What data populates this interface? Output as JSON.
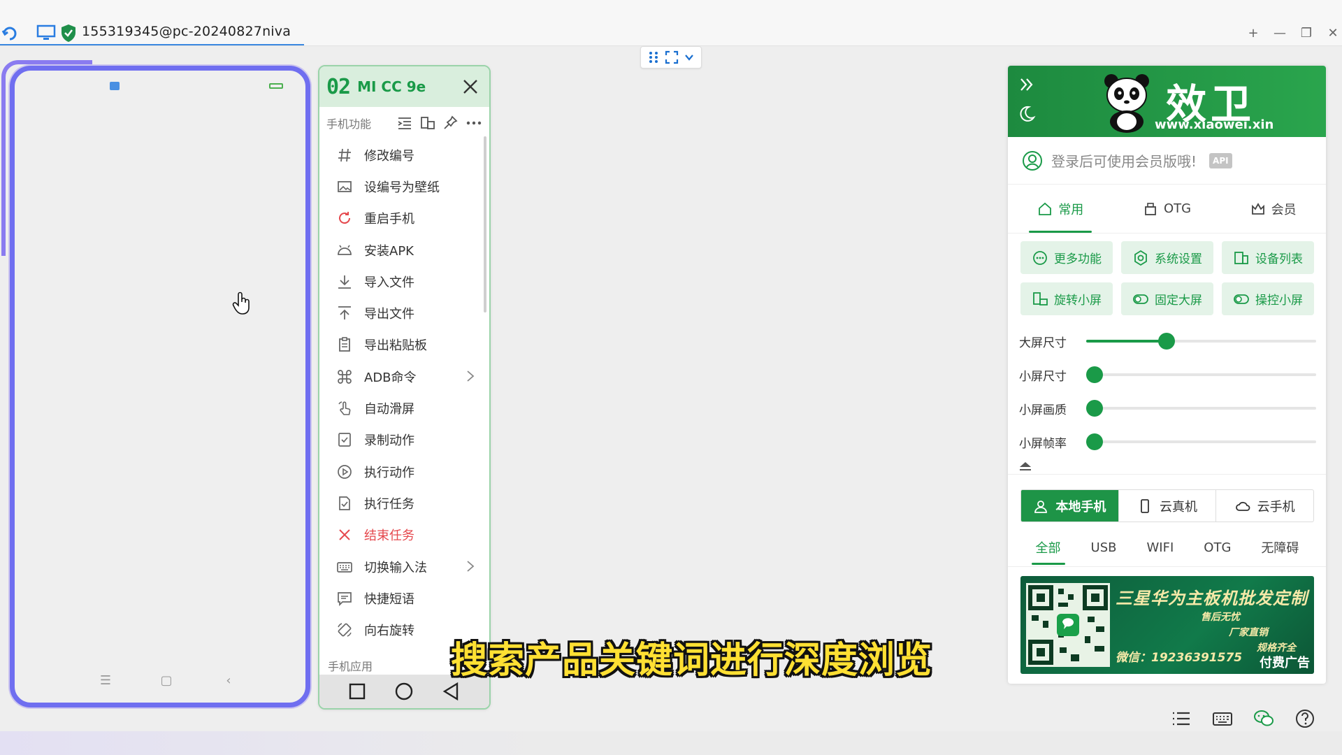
{
  "window": {
    "title": "155319345@pc-20240827niva",
    "controls": [
      "+",
      "—",
      "❐",
      "✕"
    ]
  },
  "menu": {
    "number": "02",
    "model": "MI CC 9e",
    "section_label": "手机功能",
    "apps_label": "手机应用",
    "items": [
      {
        "label": "修改编号",
        "icon": "hash-icon"
      },
      {
        "label": "设编号为壁纸",
        "icon": "image-icon"
      },
      {
        "label": "重启手机",
        "icon": "restart-icon"
      },
      {
        "label": "安装APK",
        "icon": "android-icon"
      },
      {
        "label": "导入文件",
        "icon": "download-icon"
      },
      {
        "label": "导出文件",
        "icon": "upload-icon"
      },
      {
        "label": "导出粘贴板",
        "icon": "clipboard-icon"
      },
      {
        "label": "ADB命令",
        "icon": "command-icon"
      },
      {
        "label": "自动滑屏",
        "icon": "swipe-icon"
      },
      {
        "label": "录制动作",
        "icon": "record-icon"
      },
      {
        "label": "执行动作",
        "icon": "play-icon"
      },
      {
        "label": "执行任务",
        "icon": "task-icon"
      },
      {
        "label": "结束任务",
        "icon": "close-icon"
      },
      {
        "label": "切换输入法",
        "icon": "keyboard-icon"
      },
      {
        "label": "快捷短语",
        "icon": "message-icon"
      },
      {
        "label": "向右旋转",
        "icon": "rotate-icon"
      }
    ]
  },
  "brand": {
    "name": "效卫",
    "url": "www.xiaowei.xin"
  },
  "login": {
    "text": "登录后可使用会员版哦!",
    "badge": "API"
  },
  "tabs": [
    {
      "label": "常用"
    },
    {
      "label": "OTG"
    },
    {
      "label": "会员"
    }
  ],
  "buttons": [
    {
      "label": "更多功能"
    },
    {
      "label": "系统设置"
    },
    {
      "label": "设备列表"
    },
    {
      "label": "旋转小屏"
    },
    {
      "label": "固定大屏"
    },
    {
      "label": "操控小屏"
    }
  ],
  "sliders": [
    {
      "label": "大屏尺寸",
      "value": 0.35
    },
    {
      "label": "小屏尺寸",
      "value": 0.0
    },
    {
      "label": "小屏画质",
      "value": 0.0
    },
    {
      "label": "小屏帧率",
      "value": 0.0
    }
  ],
  "device_types": [
    {
      "label": "本地手机"
    },
    {
      "label": "云真机"
    },
    {
      "label": "云手机"
    }
  ],
  "connections": [
    "全部",
    "USB",
    "WIFI",
    "OTG",
    "无障碍"
  ],
  "ad": {
    "title": "三星华为主板机批发定制",
    "line1": "售后无忧",
    "line2": "厂家直销",
    "line3": "规格齐全",
    "wechat": "微信：19236391575",
    "paid": "付费广告"
  },
  "subtitle": "搜索产品关键词进行深度浏览",
  "colors": {
    "accent": "#1a9a48",
    "phone_border": "#6f6ef0",
    "danger": "#e5484d",
    "subtitle": "#ffe033"
  }
}
